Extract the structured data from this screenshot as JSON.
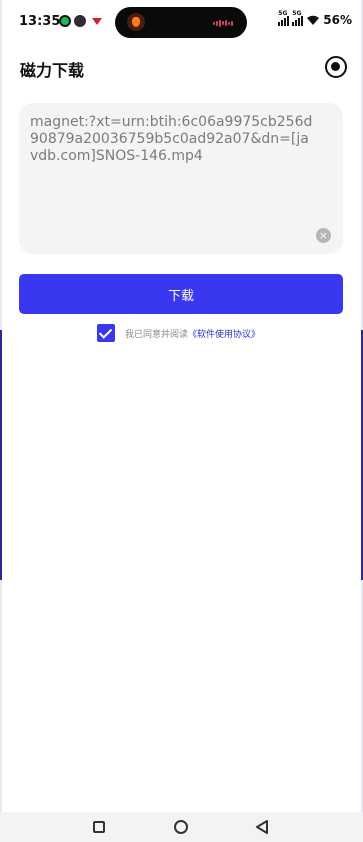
{
  "status_bar": {
    "time": "13:35",
    "network_1": "5G",
    "network_2": "5G",
    "battery": "56%"
  },
  "header": {
    "title": "磁力下载",
    "action_icon": "record-icon"
  },
  "input": {
    "value": "magnet:?xt=urn:btih:6c06a9975cb256d90879a20036759b5c0ad92a07&dn=[javdb.com]SNOS-146.mp4",
    "clear_icon": "clear-icon"
  },
  "download_button": {
    "label": "下载",
    "color": "#3a37f0"
  },
  "agreement": {
    "checked": true,
    "text": "我已同意并阅读",
    "link_text": "《软件使用协议》"
  },
  "nav": {
    "recents_icon": "square-icon",
    "home_icon": "circle-icon",
    "back_icon": "back-triangle-icon"
  }
}
